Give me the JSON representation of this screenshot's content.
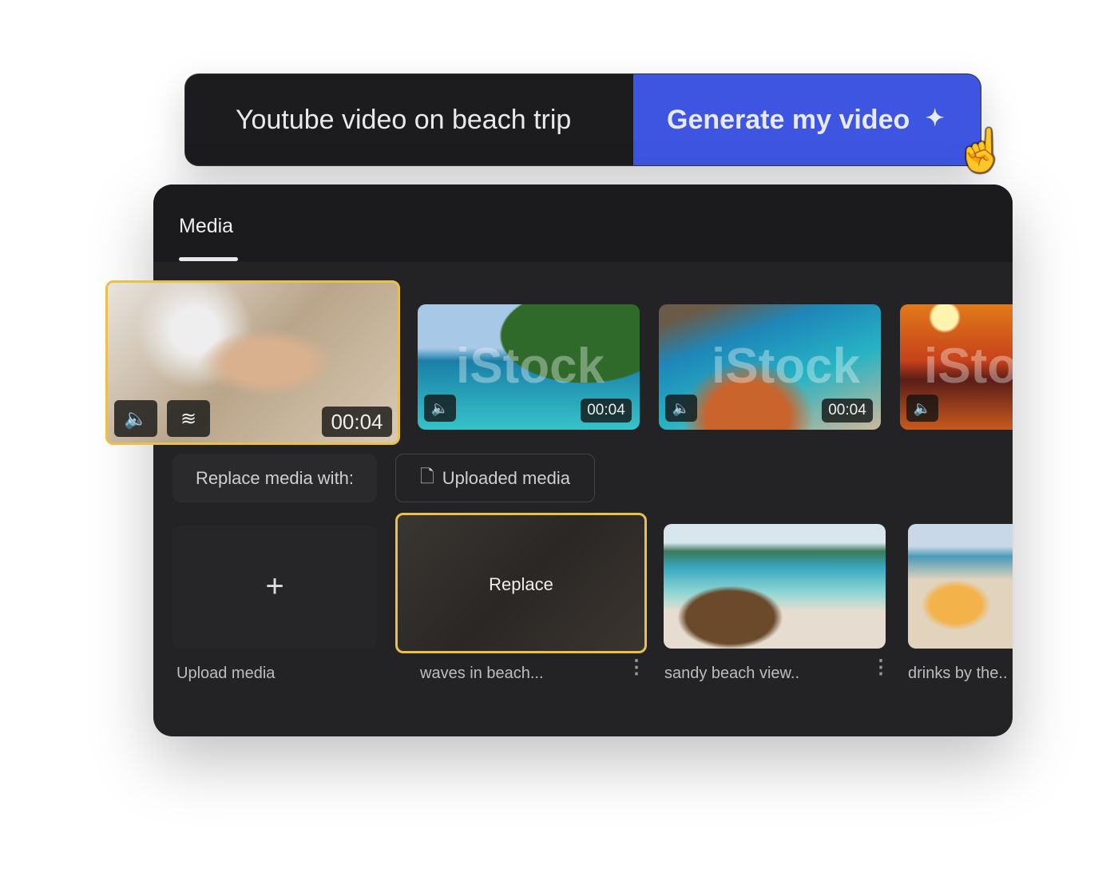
{
  "prompt_bar": {
    "text": "Youtube video on beach trip",
    "button_label": "Generate my video",
    "button_icon": "sparkle-icon",
    "accent": "#3d55e0"
  },
  "panel": {
    "tab": "Media",
    "selected_clip": {
      "duration": "00:04",
      "border_color": "#e8c04a"
    },
    "clips": [
      {
        "duration": "00:04",
        "watermark": "iStock"
      },
      {
        "duration": "00:04",
        "watermark": "iStock"
      },
      {
        "duration": "",
        "watermark": "iStock"
      }
    ],
    "replace_label": "Replace media with:",
    "uploaded_media_label": "Uploaded media",
    "upload_label": "Upload media",
    "upload_plus": "+",
    "results": [
      {
        "title": "waves in beach...",
        "overlay": "Replace"
      },
      {
        "title": "sandy beach view.."
      },
      {
        "title": "drinks by the.."
      }
    ]
  }
}
